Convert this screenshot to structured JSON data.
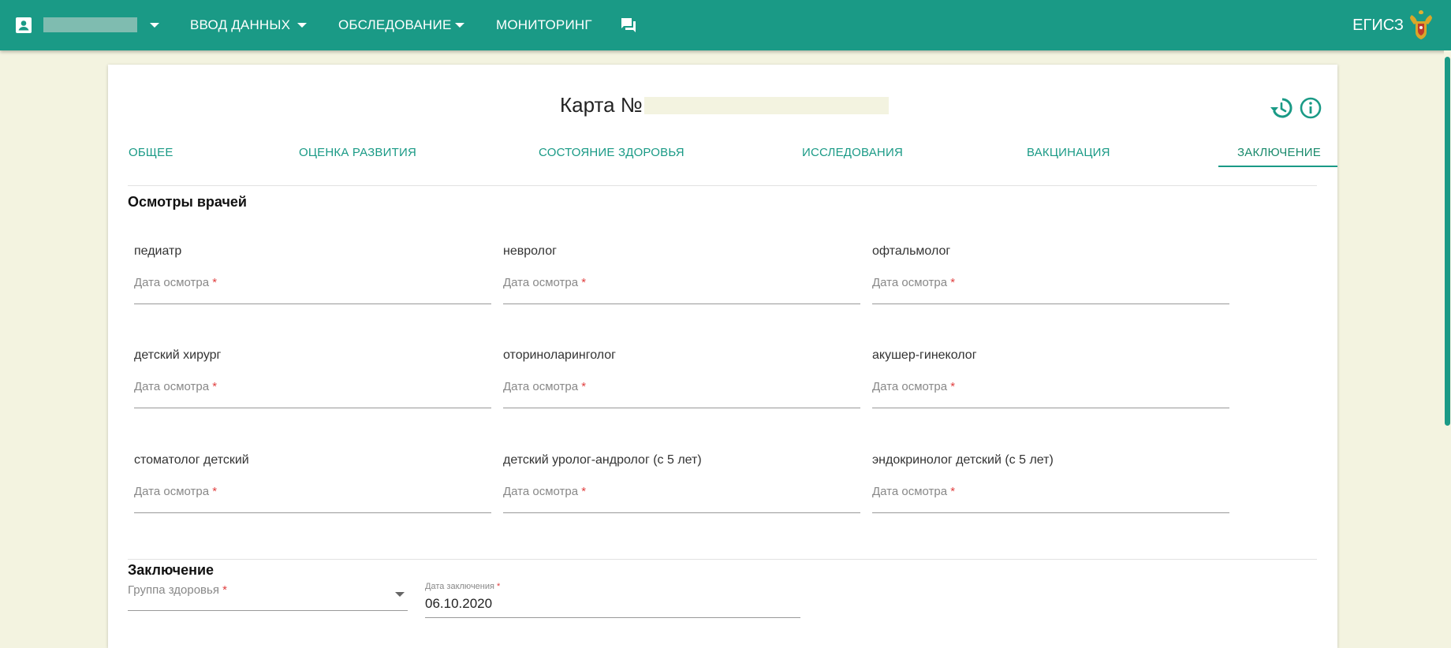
{
  "topbar": {
    "menu": [
      {
        "label": "Ввод данных"
      },
      {
        "label": "Обследование"
      },
      {
        "label": "Мониторинг"
      }
    ],
    "system_name": "ЕГИСЗ"
  },
  "card": {
    "title": "Карта №",
    "tabs": [
      {
        "label": "Общее"
      },
      {
        "label": "Оценка развития"
      },
      {
        "label": "Состояние здоровья"
      },
      {
        "label": "Исследования"
      },
      {
        "label": "Вакцинация"
      },
      {
        "label": "Заключение",
        "active": true
      }
    ],
    "exams_section": {
      "title": "Осмотры врачей",
      "field_label": "Дата осмотра",
      "required_mark": "*",
      "doctors": [
        "педиатр",
        "невролог",
        "офтальмолог",
        "детский хирург",
        "оториноларинголог",
        "акушер-гинеколог",
        "стоматолог детский",
        "детский уролог-андролог (с 5 лет)",
        "эндокринолог детский (с 5 лет)"
      ]
    },
    "conclusion_section": {
      "title": "Заключение",
      "health_group_label": "Группа здоровья",
      "date_label": "Дата заключения",
      "date_value": "06.10.2020",
      "required_mark": "*"
    }
  },
  "colors": {
    "accent": "#1a9a86",
    "page_background": "#f3f3e0",
    "required": "#e04040"
  },
  "icons": [
    "account-box-icon",
    "chevron-down-icon",
    "chat-icon",
    "emblem-icon",
    "history-icon",
    "info-icon",
    "dropdown-arrow-icon"
  ]
}
